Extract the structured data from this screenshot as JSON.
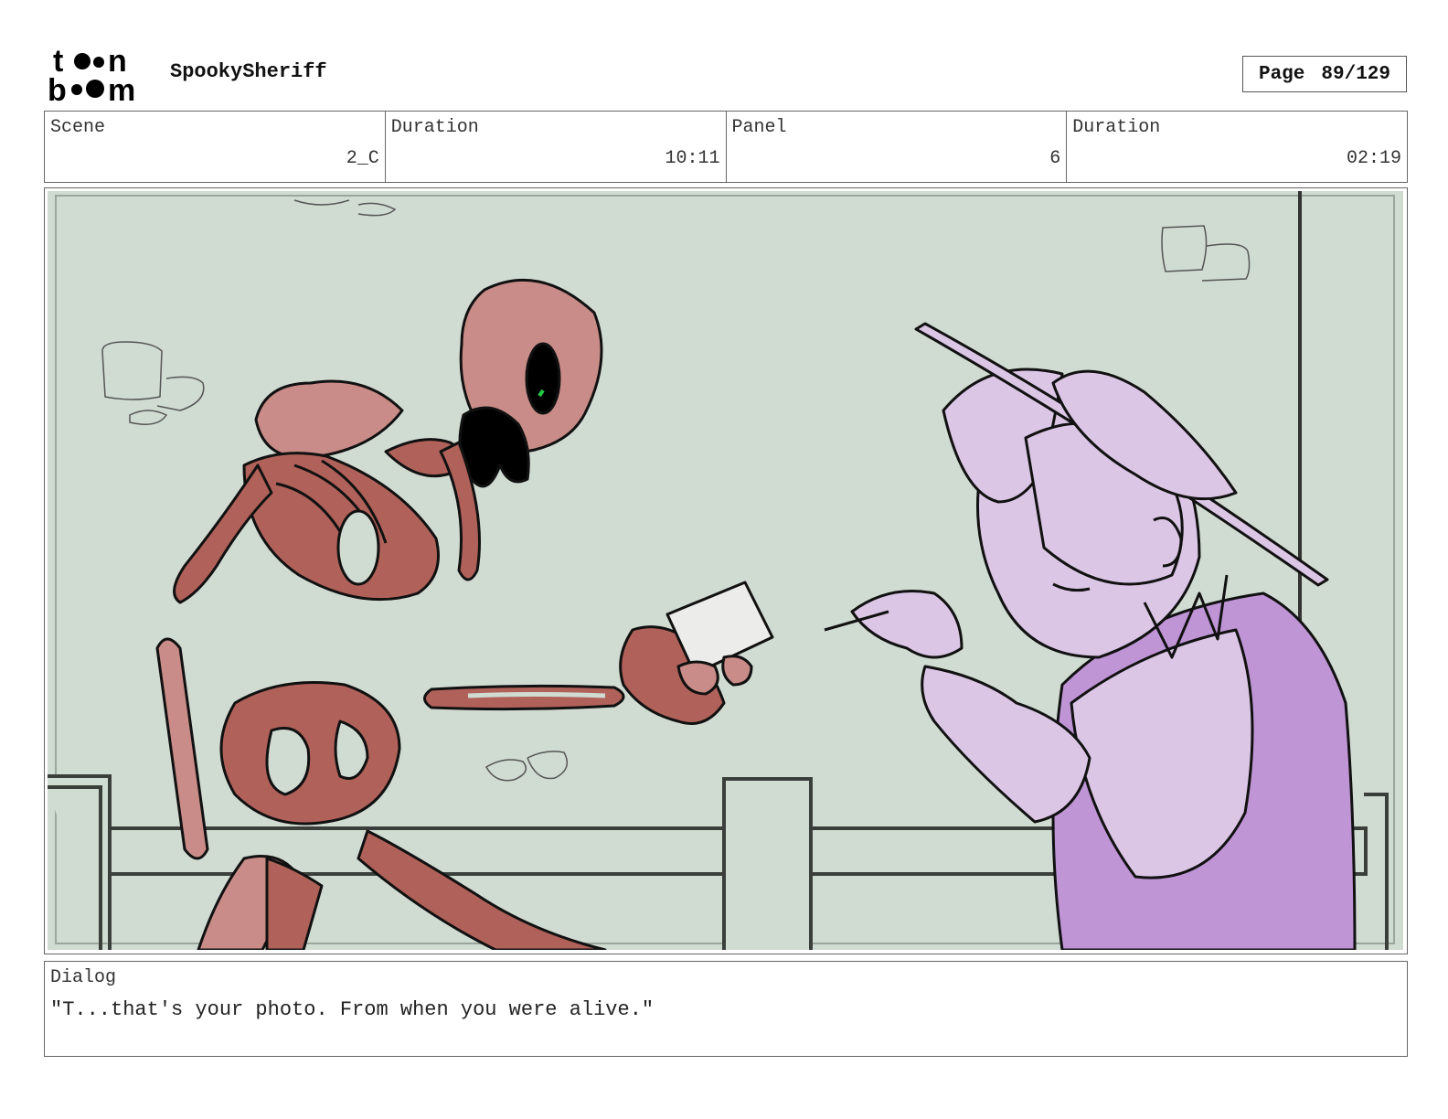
{
  "header": {
    "logo_text_top": "toon",
    "logo_text_bottom": "boom",
    "project_title": "SpookySheriff",
    "page_label": "Page",
    "page_value": "89/129"
  },
  "info": {
    "scene_label": "Scene",
    "scene_value": "2_C",
    "scene_duration_label": "Duration",
    "scene_duration_value": "10:11",
    "panel_label": "Panel",
    "panel_value": "6",
    "panel_duration_label": "Duration",
    "panel_duration_value": "02:19"
  },
  "dialog": {
    "label": "Dialog",
    "text": "\"T...that's your photo. From when you were alive.\""
  },
  "colors": {
    "background_wall": "#d0dbd2",
    "skeleton": "#c98c88",
    "skeleton_shadow": "#b0625a",
    "sheriff": "#dcc6e6",
    "sheriff_shadow": "#bf95d6",
    "eye_glint": "#22cc44",
    "line": "#111111"
  }
}
